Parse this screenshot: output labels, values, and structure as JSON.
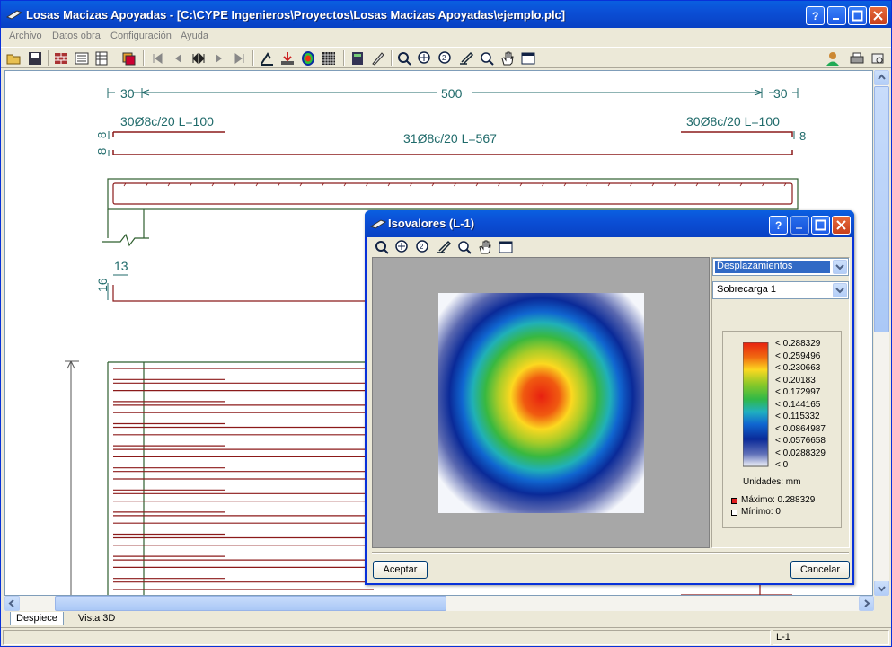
{
  "window": {
    "title": "Losas Macizas Apoyadas - [C:\\CYPE Ingenieros\\Proyectos\\Losas Macizas Apoyadas\\ejemplo.plc]"
  },
  "menu": [
    "Archivo",
    "Datos obra",
    "Configuración",
    "Ayuda"
  ],
  "drawing": {
    "dims_top": [
      "30",
      "500",
      "30"
    ],
    "rebar_left": "30Ø8c/20 L=100",
    "rebar_right": "30Ø8c/20 L=100",
    "rebar_main": "31Ø8c/20 L=567",
    "side_8a": "8",
    "side_8b": "8",
    "side_8c": "8",
    "dim_13": "13",
    "dim_16": "16"
  },
  "tabs": [
    "Despiece",
    "Vista 3D"
  ],
  "status": {
    "right_pane": "L-1"
  },
  "dialog": {
    "title": "Isovalores (L-1)",
    "combo_type": "Desplazamientos",
    "combo_load": "Sobrecarga 1",
    "legend": [
      "< 0.288329",
      "< 0.259496",
      "< 0.230663",
      "< 0.20183",
      "< 0.172997",
      "< 0.144165",
      "< 0.115332",
      "< 0.0864987",
      "< 0.0576658",
      "< 0.0288329",
      "< 0"
    ],
    "units": "Unidades: mm",
    "max": "Máximo: 0.288329",
    "min": "Mínimo: 0",
    "accept": "Aceptar",
    "cancel": "Cancelar"
  },
  "colors": {
    "titlebar": "#0b4fd6",
    "rebar": "#8b1a1a",
    "dim": "#1f6a6a",
    "concrete": "#2f5f2f"
  }
}
